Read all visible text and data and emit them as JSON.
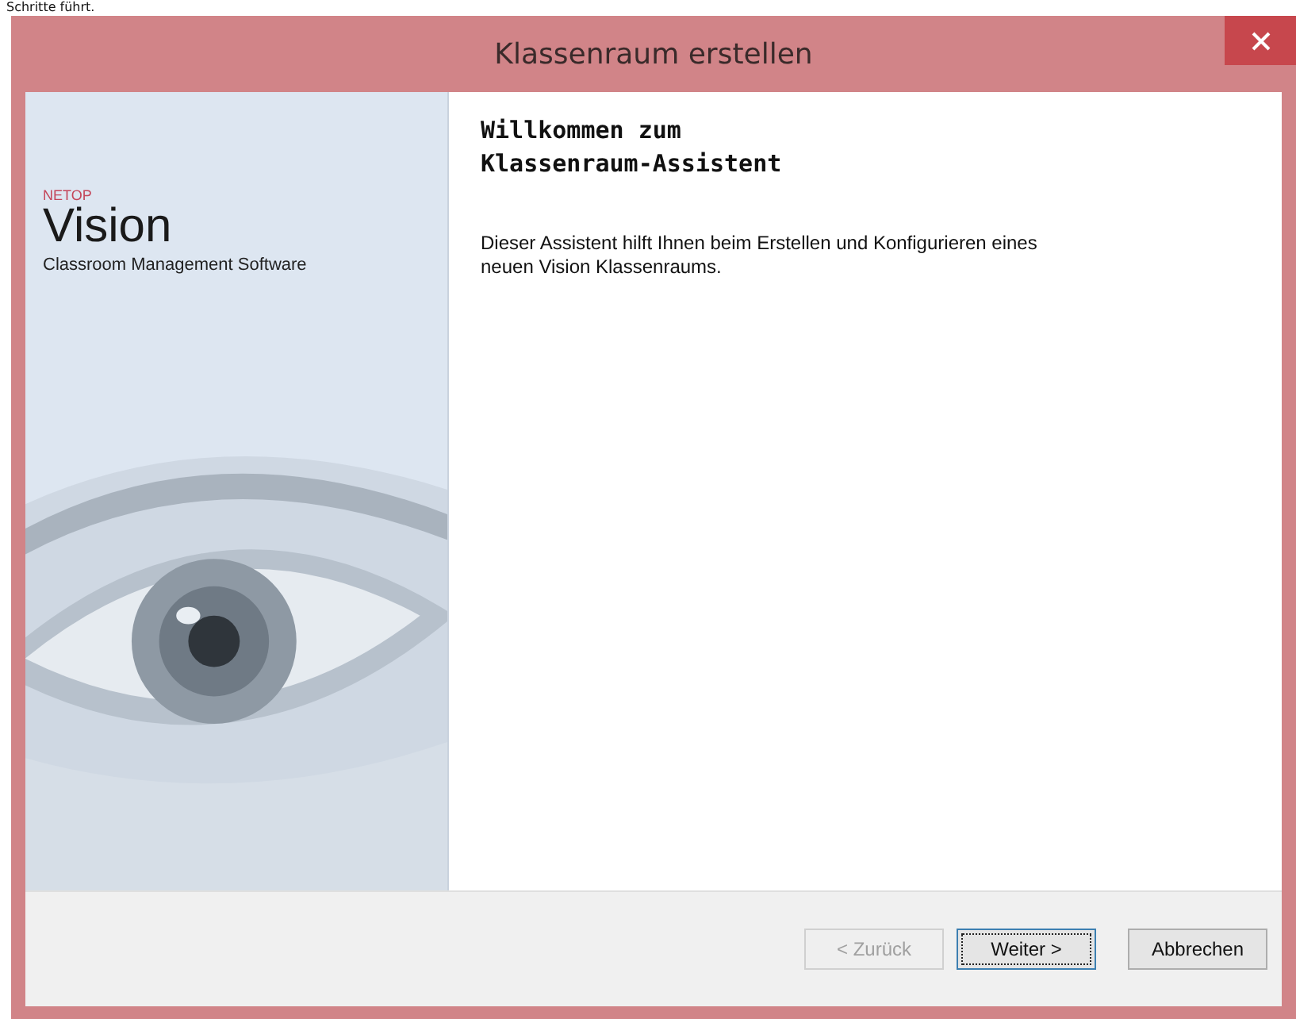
{
  "page_caption": "Schritte führt.",
  "window": {
    "title": "Klassenraum erstellen"
  },
  "brand": {
    "vendor": "NETOP",
    "product": "Vision",
    "tagline": "Classroom Management Software"
  },
  "content": {
    "heading": "Willkommen zum\nKlassenraum-Assistent",
    "text": "Dieser Assistent hilft Ihnen beim Erstellen und Konfigurieren eines neuen Vision Klassenraums."
  },
  "buttons": [
    {
      "label": "< Zurück",
      "disabled": true,
      "focused": false
    },
    {
      "label": "Weiter >",
      "disabled": false,
      "focused": true
    },
    {
      "label": "Abbrechen",
      "disabled": false,
      "focused": false
    }
  ]
}
